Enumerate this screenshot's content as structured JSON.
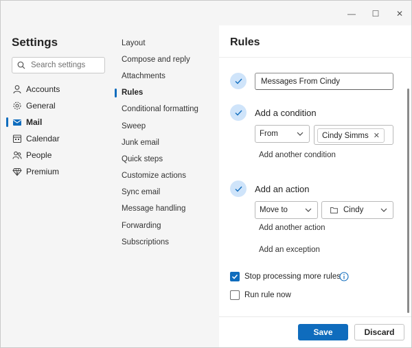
{
  "window": {
    "minimize": "—",
    "maximize": "☐",
    "close": "✕"
  },
  "settings": {
    "title": "Settings",
    "search_placeholder": "Search settings",
    "categories": [
      {
        "label": "Accounts",
        "icon": "person-icon"
      },
      {
        "label": "General",
        "icon": "gear-icon"
      },
      {
        "label": "Mail",
        "icon": "mail-icon",
        "active": true
      },
      {
        "label": "Calendar",
        "icon": "calendar-icon"
      },
      {
        "label": "People",
        "icon": "people-icon"
      },
      {
        "label": "Premium",
        "icon": "diamond-icon"
      }
    ]
  },
  "mail_menu": [
    "Layout",
    "Compose and reply",
    "Attachments",
    "Rules",
    "Conditional formatting",
    "Sweep",
    "Junk email",
    "Quick steps",
    "Customize actions",
    "Sync email",
    "Message handling",
    "Forwarding",
    "Subscriptions"
  ],
  "mail_menu_active": "Rules",
  "rules": {
    "title": "Rules",
    "rule_name": "Messages From Cindy",
    "condition": {
      "heading": "Add a condition",
      "field": "From",
      "chip": "Cindy Simms",
      "add_another": "Add another condition"
    },
    "action": {
      "heading": "Add an action",
      "field": "Move to",
      "folder": "Cindy",
      "add_another": "Add another action",
      "add_exception": "Add an exception"
    },
    "stop_processing": {
      "label": "Stop processing more rules",
      "checked": true
    },
    "run_now": {
      "label": "Run rule now",
      "checked": false
    },
    "save": "Save",
    "discard": "Discard"
  },
  "colors": {
    "accent": "#0f6cbd",
    "step_circle": "#cfe4fa"
  }
}
